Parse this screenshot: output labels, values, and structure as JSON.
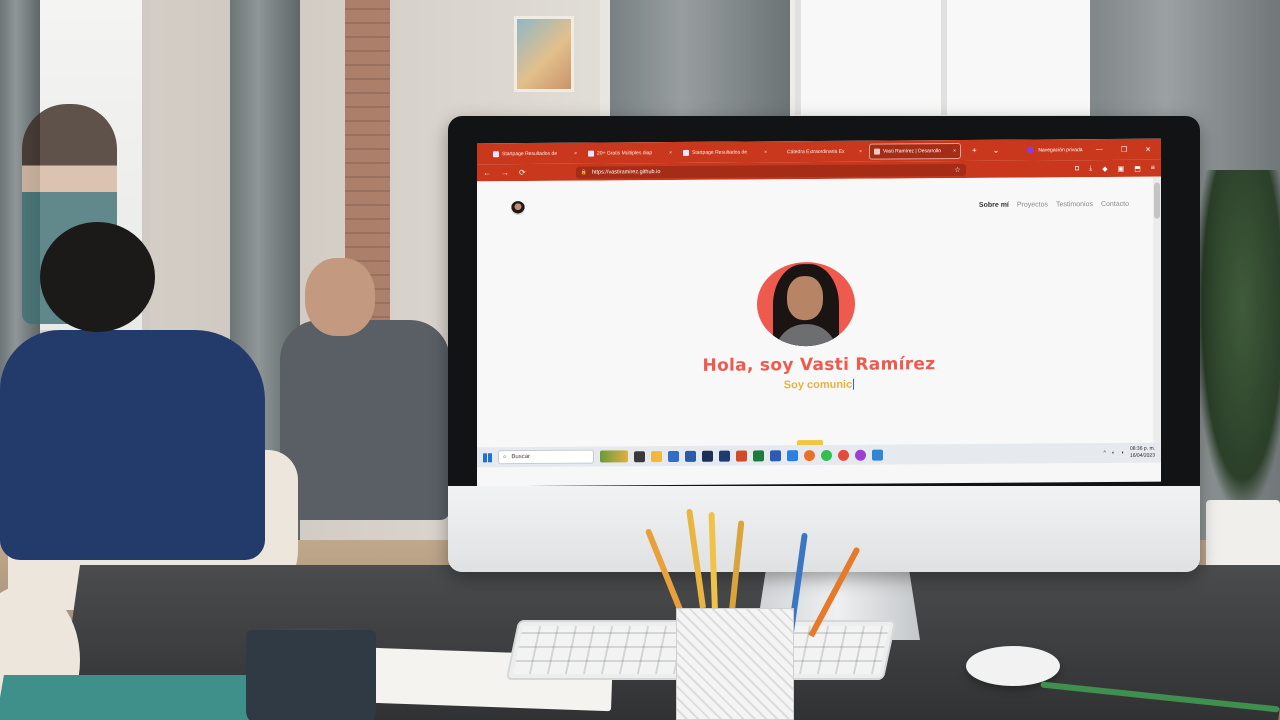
{
  "browser": {
    "tabs": [
      {
        "label": "Startpage Resultados de",
        "active": false
      },
      {
        "label": "20+ Gratis Múltiples diap",
        "active": false
      },
      {
        "label": "Startpage Resultados de",
        "active": false
      },
      {
        "label": "Cátedra Extraordinaria Ex",
        "active": false
      },
      {
        "label": "Vasti Ramírez | Desarrollo",
        "active": true
      }
    ],
    "tab_close_glyph": "×",
    "new_tab_glyph": "+",
    "tab_list_glyph": "⌄",
    "private_label": "Navegación privada",
    "url": "https://vastiramirez.github.io"
  },
  "page": {
    "nav": {
      "about": "Sobre mí",
      "projects": "Proyectos",
      "testimonials": "Testimonios",
      "contact": "Contacto"
    },
    "hero_title": "Hola, soy Vasti Ramírez",
    "hero_subtitle": "Soy comunic"
  },
  "taskbar": {
    "search_placeholder": "Buscar",
    "time": "08:36 p. m.",
    "date": "16/04/2023"
  },
  "colors": {
    "browser_accent": "#c9381d",
    "hero_title": "#ee5a4d",
    "hero_subtitle": "#e9b23c"
  },
  "icons": {
    "back": "←",
    "forward": "→",
    "reload": "⟳",
    "lock": "🔒",
    "star": "☆",
    "search": "⌕",
    "minimize": "—",
    "maximize": "❐",
    "close": "✕"
  }
}
